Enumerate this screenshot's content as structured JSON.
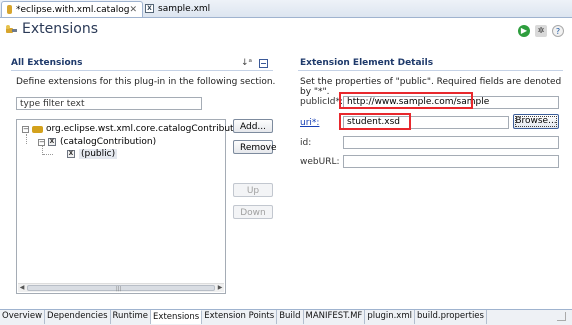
{
  "editor_tabs": [
    {
      "label": "*eclipse.with.xml.catalog",
      "close": "✕",
      "active": true
    },
    {
      "label": "sample.xml",
      "active": false
    }
  ],
  "header": {
    "title": "Extensions"
  },
  "all_extensions": {
    "title": "All Extensions",
    "description": "Define extensions for this plug-in in the following section.",
    "filter_value": "type filter text",
    "tree": [
      {
        "label": "org.eclipse.wst.xml.core.catalogContributions",
        "level": 0,
        "expanded": true
      },
      {
        "label": "(catalogContribution)",
        "level": 1,
        "expanded": true
      },
      {
        "label": "(public)",
        "level": 2,
        "selected": true
      }
    ],
    "buttons": {
      "add": "Add...",
      "remove": "Remove",
      "up": "Up",
      "down": "Down"
    }
  },
  "details": {
    "title": "Extension Element Details",
    "description": "Set the properties of \"public\". Required fields are denoted by \"*\".",
    "fields": {
      "publicId": {
        "label": "publicId*:",
        "value": "http://www.sample.com/sample"
      },
      "uri": {
        "label": "uri*:",
        "value": "student.xsd",
        "browse": "Browse..."
      },
      "id": {
        "label": "id:",
        "value": ""
      },
      "webURL": {
        "label": "webURL:",
        "value": ""
      }
    }
  },
  "bottom_tabs": [
    "Overview",
    "Dependencies",
    "Runtime",
    "Extensions",
    "Extension Points",
    "Build",
    "MANIFEST.MF",
    "plugin.xml",
    "build.properties"
  ],
  "active_bottom_tab": "Extensions",
  "colors": {
    "highlight": "#e8282d",
    "section_title": "#1f3a6b",
    "link": "#1740b5"
  }
}
